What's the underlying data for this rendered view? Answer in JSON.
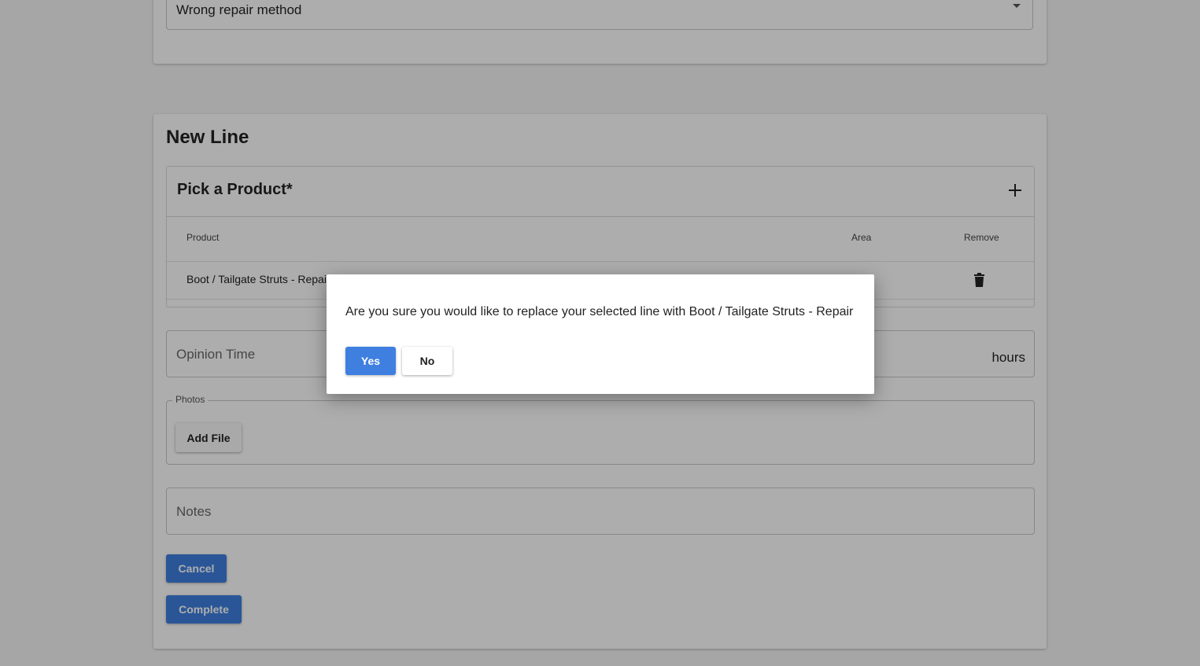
{
  "top_card": {
    "reason_select_value": "Wrong repair method"
  },
  "new_line": {
    "title": "New Line",
    "product_picker": {
      "title": "Pick a Product*",
      "columns": {
        "product": "Product",
        "area": "Area",
        "remove": "Remove"
      },
      "rows": [
        {
          "product": "Boot / Tailgate Struts - Repair",
          "area": ""
        }
      ]
    },
    "opinion_time": {
      "placeholder": "Opinion Time",
      "unit": "hours"
    },
    "photos": {
      "legend": "Photos",
      "add_file_label": "Add File"
    },
    "notes": {
      "placeholder": "Notes"
    },
    "cancel_label": "Cancel",
    "complete_label": "Complete"
  },
  "dialog": {
    "message": "Are you sure you would like to replace your selected line with Boot / Tailgate Struts - Repair",
    "yes_label": "Yes",
    "no_label": "No"
  },
  "colors": {
    "primary": "#3f7fe0",
    "overlay": "rgba(0,0,0,0.32)"
  },
  "icons": [
    "chevron-down-icon",
    "plus-icon",
    "trash-icon"
  ]
}
